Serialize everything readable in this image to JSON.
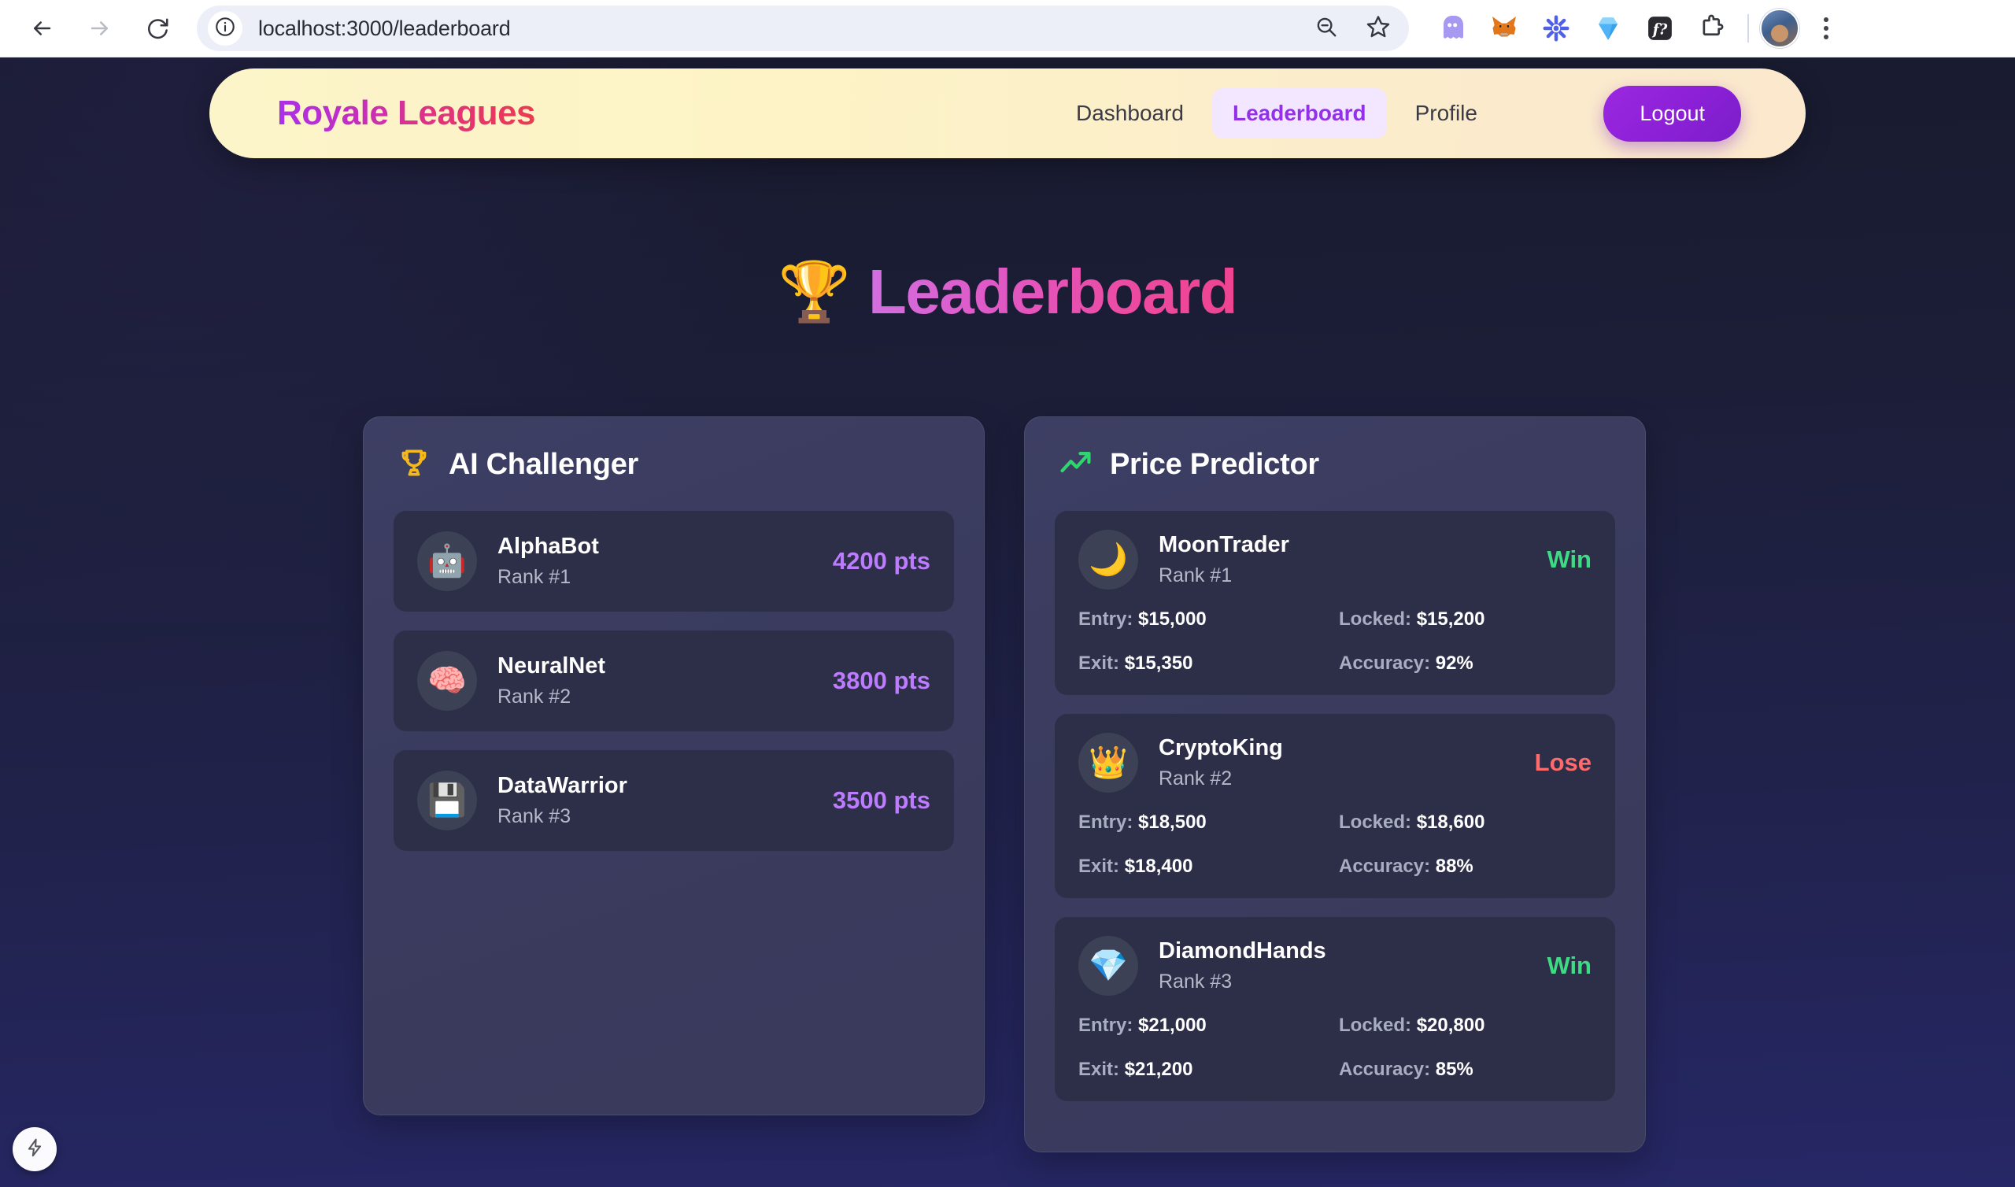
{
  "browser": {
    "url": "localhost:3000/leaderboard",
    "back_label": "back-arrow",
    "forward_label": "forward-arrow",
    "reload_label": "reload",
    "site_info_label": "info",
    "zoom_out_label": "zoom-out",
    "bookmark_label": "bookmark-star",
    "extensions": [
      {
        "name": "ghost-extension-icon",
        "glyph": "👻"
      },
      {
        "name": "metamask-fox-icon",
        "glyph": "🦊"
      },
      {
        "name": "blue-asterisk-icon",
        "glyph": "✻"
      },
      {
        "name": "blue-diamond-icon",
        "glyph": "💎"
      },
      {
        "name": "math-formula-icon",
        "glyph": "ƒ?"
      },
      {
        "name": "puzzle-extensions-icon",
        "glyph": "⬜"
      }
    ],
    "menu_label": "chrome-menu"
  },
  "appbar": {
    "brand": "Royale Leagues",
    "nav": [
      {
        "label": "Dashboard",
        "active": false
      },
      {
        "label": "Leaderboard",
        "active": true
      },
      {
        "label": "Profile",
        "active": false
      }
    ],
    "logout_label": "Logout"
  },
  "header": {
    "title": "Leaderboard",
    "trophy_icon": "🏆"
  },
  "panels": [
    {
      "key": "ai_challenger",
      "title": "AI Challenger",
      "icon": "trophy-icon",
      "icon_color": "#f5b81d",
      "type": "points",
      "rows": [
        {
          "avatar": "🤖",
          "avatar_name": "robot-emoji",
          "name": "AlphaBot",
          "rank": "Rank #1",
          "score": "4200 pts"
        },
        {
          "avatar": "🧠",
          "avatar_name": "brain-emoji",
          "name": "NeuralNet",
          "rank": "Rank #2",
          "score": "3800 pts"
        },
        {
          "avatar": "💾",
          "avatar_name": "floppy-disk-emoji",
          "name": "DataWarrior",
          "rank": "Rank #3",
          "score": "3500 pts"
        }
      ]
    },
    {
      "key": "price_predictor",
      "title": "Price Predictor",
      "icon": "trending-up-icon",
      "icon_color": "#2fd56f",
      "type": "trades",
      "rows": [
        {
          "avatar": "🌙",
          "avatar_name": "crescent-moon-emoji",
          "name": "MoonTrader",
          "rank": "Rank #1",
          "result": "Win",
          "result_state": "win",
          "entry_label": "Entry:",
          "entry_value": "$15,000",
          "locked_label": "Locked:",
          "locked_value": "$15,200",
          "exit_label": "Exit:",
          "exit_value": "$15,350",
          "accuracy_label": "Accuracy:",
          "accuracy_value": "92%"
        },
        {
          "avatar": "👑",
          "avatar_name": "crown-emoji",
          "name": "CryptoKing",
          "rank": "Rank #2",
          "result": "Lose",
          "result_state": "lose",
          "entry_label": "Entry:",
          "entry_value": "$18,500",
          "locked_label": "Locked:",
          "locked_value": "$18,600",
          "exit_label": "Exit:",
          "exit_value": "$18,400",
          "accuracy_label": "Accuracy:",
          "accuracy_value": "88%"
        },
        {
          "avatar": "💎",
          "avatar_name": "gem-emoji",
          "name": "DiamondHands",
          "rank": "Rank #3",
          "result": "Win",
          "result_state": "win",
          "entry_label": "Entry:",
          "entry_value": "$21,000",
          "locked_label": "Locked:",
          "locked_value": "$20,800",
          "exit_label": "Exit:",
          "exit_value": "$21,200",
          "accuracy_label": "Accuracy:",
          "accuracy_value": "85%"
        }
      ]
    }
  ],
  "fab": {
    "icon": "lightning-bolt-icon"
  },
  "colors": {
    "accent_purple": "#9b28e0",
    "score_purple": "#bd7cff",
    "win_green": "#3ddc84",
    "lose_red": "#ff6b6b",
    "trophy_gold": "#f5b81d",
    "navbar_cream": "#fcf5c9"
  }
}
